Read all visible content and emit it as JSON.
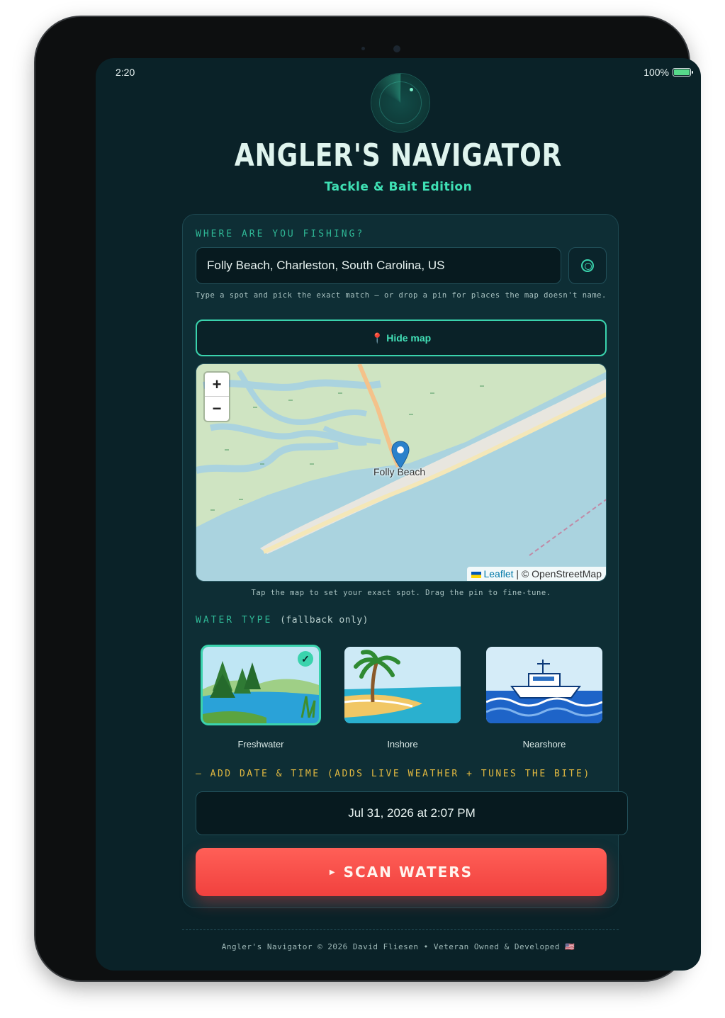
{
  "status": {
    "time": "2:20",
    "battery": "100%",
    "battery_level": 1.0
  },
  "header": {
    "title": "ANGLER'S NAVIGATOR",
    "subtitle": "Tackle & Bait Edition"
  },
  "location": {
    "label": "WHERE ARE YOU FISHING?",
    "value": "Folly Beach, Charleston, South Carolina, US",
    "hint": "Type a spot and pick the exact match — or drop a pin for places the map doesn't name.",
    "map_toggle_label": "Hide map"
  },
  "map": {
    "place": "Folly Beach",
    "zoom_in": "+",
    "zoom_out": "−",
    "attribution_leaflet": "Leaflet",
    "attribution_osm": "© OpenStreetMap",
    "hint": "Tap the map to set your exact spot. Drag the pin to fine-tune."
  },
  "water": {
    "label": "WATER TYPE",
    "sublabel": "(fallback only)",
    "options": [
      {
        "name": "Freshwater",
        "selected": true
      },
      {
        "name": "Inshore",
        "selected": false
      },
      {
        "name": "Nearshore",
        "selected": false
      }
    ]
  },
  "datetime": {
    "toggle": "— ADD DATE & TIME (ADDS LIVE WEATHER + TUNES THE BITE)",
    "value": "Jul 31, 2026 at 2:07 PM"
  },
  "scan": {
    "label": "SCAN WATERS"
  },
  "footer": {
    "text": "Angler's Navigator © 2026 David Fliesen • Veteran Owned & Developed 🇺🇸"
  },
  "colors": {
    "accent": "#3ad3ad",
    "danger": "#f1413e",
    "gold": "#e0b840",
    "background": "#0a2228"
  }
}
